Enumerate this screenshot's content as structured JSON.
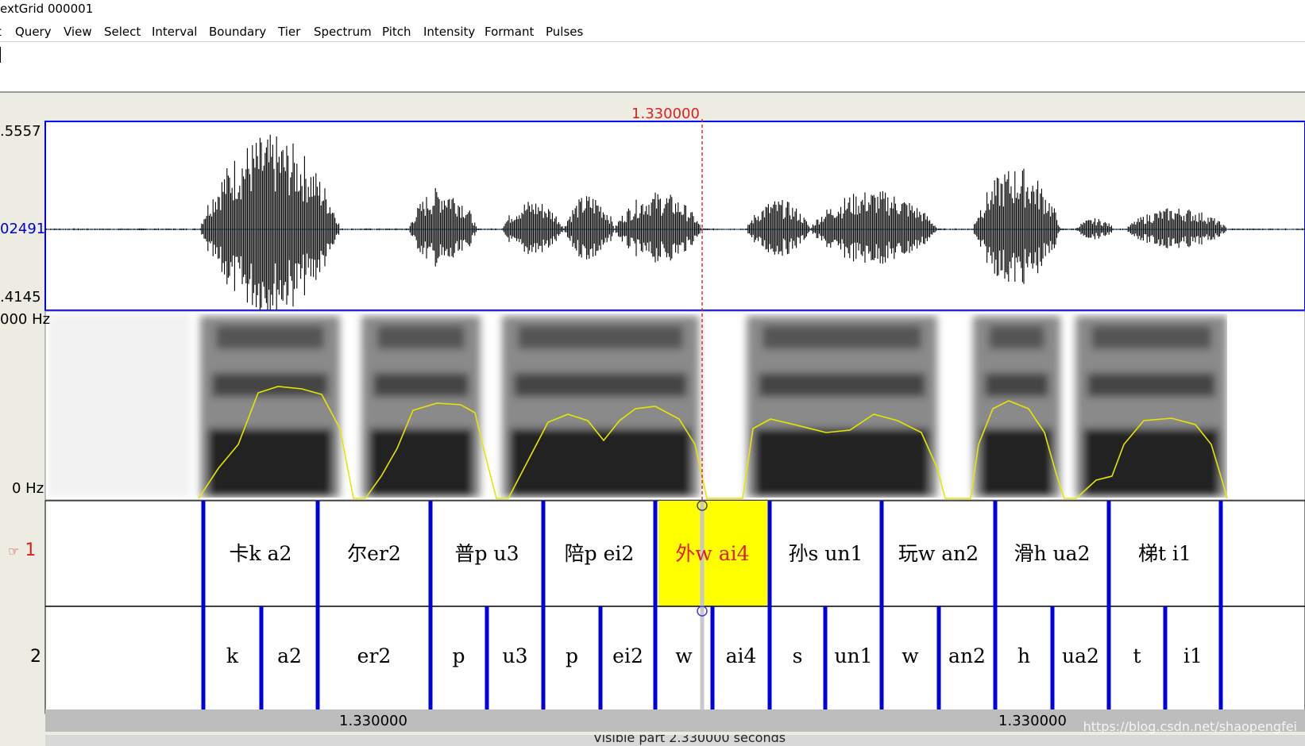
{
  "window": {
    "title": "extGrid 000001"
  },
  "menu": [
    {
      "label": "t"
    },
    {
      "label": "Query"
    },
    {
      "label": "View"
    },
    {
      "label": "Select"
    },
    {
      "label": "Interval"
    },
    {
      "label": "Boundary"
    },
    {
      "label": "Tier"
    },
    {
      "label": "Spectrum"
    },
    {
      "label": "Pitch"
    },
    {
      "label": "Intensity"
    },
    {
      "label": "Formant"
    },
    {
      "label": "Pulses"
    }
  ],
  "waveform": {
    "max_label": ".5557",
    "zero_label": "02491",
    "min_label": ".4145"
  },
  "spectrogram": {
    "top_label": "000 Hz",
    "bottom_label": "0 Hz"
  },
  "cursor": {
    "time": "1.330000"
  },
  "tiers": [
    {
      "number": "1",
      "pointer_icon": "pointing-hand-icon",
      "intervals": [
        "卡k a2",
        "尔er2",
        "普p u3",
        "陪p ei2",
        "外w ai4",
        "孙s un1",
        "玩w an2",
        "滑h ua2",
        "梯t i1"
      ],
      "selected_index": 4
    },
    {
      "number": "2",
      "intervals": [
        "k",
        "a2",
        "er2",
        "p",
        "u3",
        "p",
        "ei2",
        "w",
        "ai4",
        "s",
        "un1",
        "w",
        "an2",
        "h",
        "ua2",
        "t",
        "i1"
      ]
    }
  ],
  "bottom": {
    "left_time": "1.330000",
    "right_time": "1.330000",
    "visible_text": "Visible part 2.330000 seconds"
  },
  "watermark": "https://blog.csdn.net/shaopengfei",
  "colors": {
    "boundary": "#0000dd",
    "selection": "#ffff00",
    "cursor": "#e02020",
    "pitch": "#e6e600",
    "waveform": "#000000"
  }
}
